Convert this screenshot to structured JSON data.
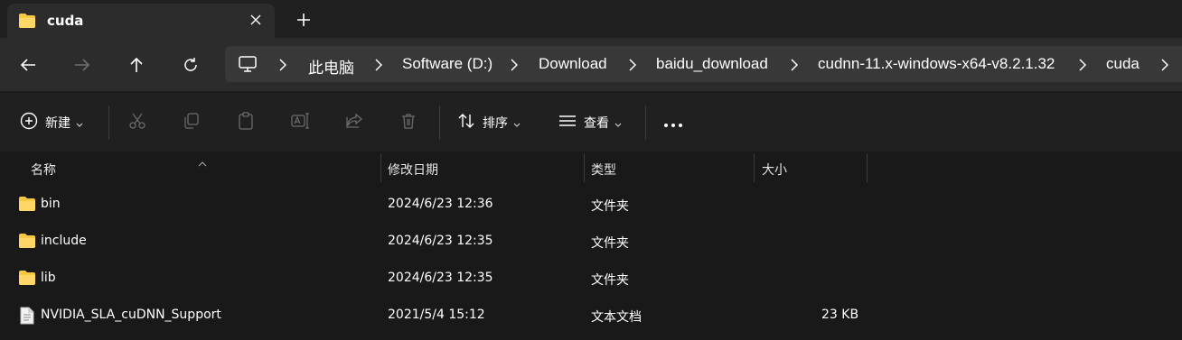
{
  "tab": {
    "title": "cuda",
    "close_icon": "close-icon",
    "new_tab_icon": "plus-icon"
  },
  "nav": {
    "back": "arrow-left-icon",
    "forward": "arrow-right-icon",
    "up": "arrow-up-icon",
    "refresh": "refresh-icon"
  },
  "breadcrumbs": [
    "此电脑",
    "Software (D:)",
    "Download",
    "baidu_download",
    "cudnn-11.x-windows-x64-v8.2.1.32",
    "cuda"
  ],
  "commands": {
    "new_label": "新建",
    "sort_label": "排序",
    "view_label": "查看",
    "more": "more-icon"
  },
  "columns": {
    "name": "名称",
    "modified": "修改日期",
    "type": "类型",
    "size": "大小"
  },
  "files": [
    {
      "name": "bin",
      "modified": "2024/6/23 12:36",
      "type": "文件夹",
      "size": "",
      "icon": "folder-icon"
    },
    {
      "name": "include",
      "modified": "2024/6/23 12:35",
      "type": "文件夹",
      "size": "",
      "icon": "folder-icon"
    },
    {
      "name": "lib",
      "modified": "2024/6/23 12:35",
      "type": "文件夹",
      "size": "",
      "icon": "folder-icon"
    },
    {
      "name": "NVIDIA_SLA_cuDNN_Support",
      "modified": "2021/5/4 15:12",
      "type": "文本文档",
      "size": "23 KB",
      "icon": "text-file-icon"
    }
  ],
  "colors": {
    "folder": "#f8c842",
    "background": "#191919",
    "toolbar": "#2c2c2c"
  }
}
